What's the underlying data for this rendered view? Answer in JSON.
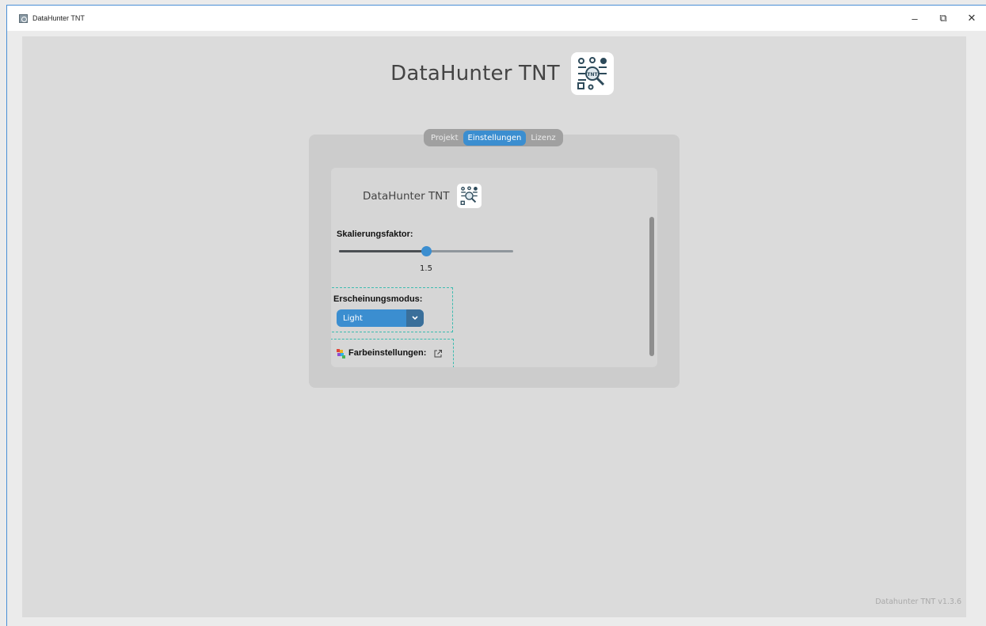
{
  "window": {
    "title": "DataHunter TNT",
    "minimize": "–",
    "restore": "⧉",
    "close": "✕"
  },
  "header": {
    "title": "DataHunter TNT",
    "logo_icon": "datahunter-logo-icon"
  },
  "tabs": [
    {
      "label": "Projekt",
      "active": false
    },
    {
      "label": "Einstellungen",
      "active": true
    },
    {
      "label": "Lizenz",
      "active": false
    }
  ],
  "settings": {
    "title": "DataHunter TNT",
    "scale_label": "Skalierungsfaktor:",
    "scale_value": "1.5",
    "scale_fraction": 0.5,
    "appearance_label": "Erscheinungsmodus:",
    "appearance_value": "Light",
    "color_label": "Farbeinstellungen:",
    "color_icon": "palette-icon",
    "external_icon": "external-link-icon"
  },
  "footer": {
    "version": "Datahunter TNT v1.3.6"
  },
  "colors": {
    "accent": "#3b8ed0",
    "background": "#dbdbdb",
    "panel": "#cccccc",
    "dashed_outline": "#3dbcb0"
  }
}
